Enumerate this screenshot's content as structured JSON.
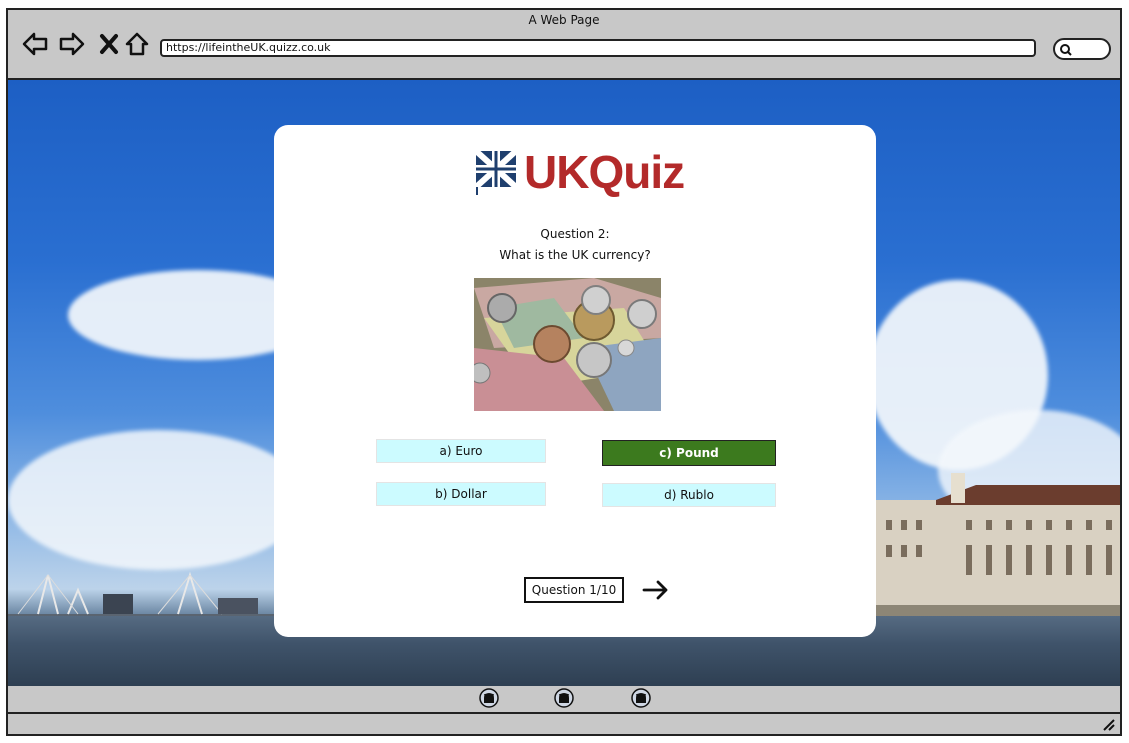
{
  "window": {
    "title": "A Web Page"
  },
  "browser": {
    "url": "https://lifeintheUK.quizz.co.uk"
  },
  "logo": {
    "text": "UKQuiz"
  },
  "question": {
    "number_label": "Question 2:",
    "text": "What is the UK currency?"
  },
  "answers": [
    {
      "label": "a) Euro",
      "selected": false
    },
    {
      "label": "b) Dollar",
      "selected": false
    },
    {
      "label": "c) Pound",
      "selected": true
    },
    {
      "label": "d) Rublo",
      "selected": false
    }
  ],
  "progress": {
    "counter_label": "Question 1/10"
  },
  "footer": {
    "icons": [
      "github-icon",
      "github-icon",
      "github-icon"
    ]
  },
  "colors": {
    "logo_red": "#b32a2a",
    "selected_green": "#3c7a1e",
    "answer_bg": "#ccfbff",
    "flag_blue": "#1f3f6e"
  }
}
